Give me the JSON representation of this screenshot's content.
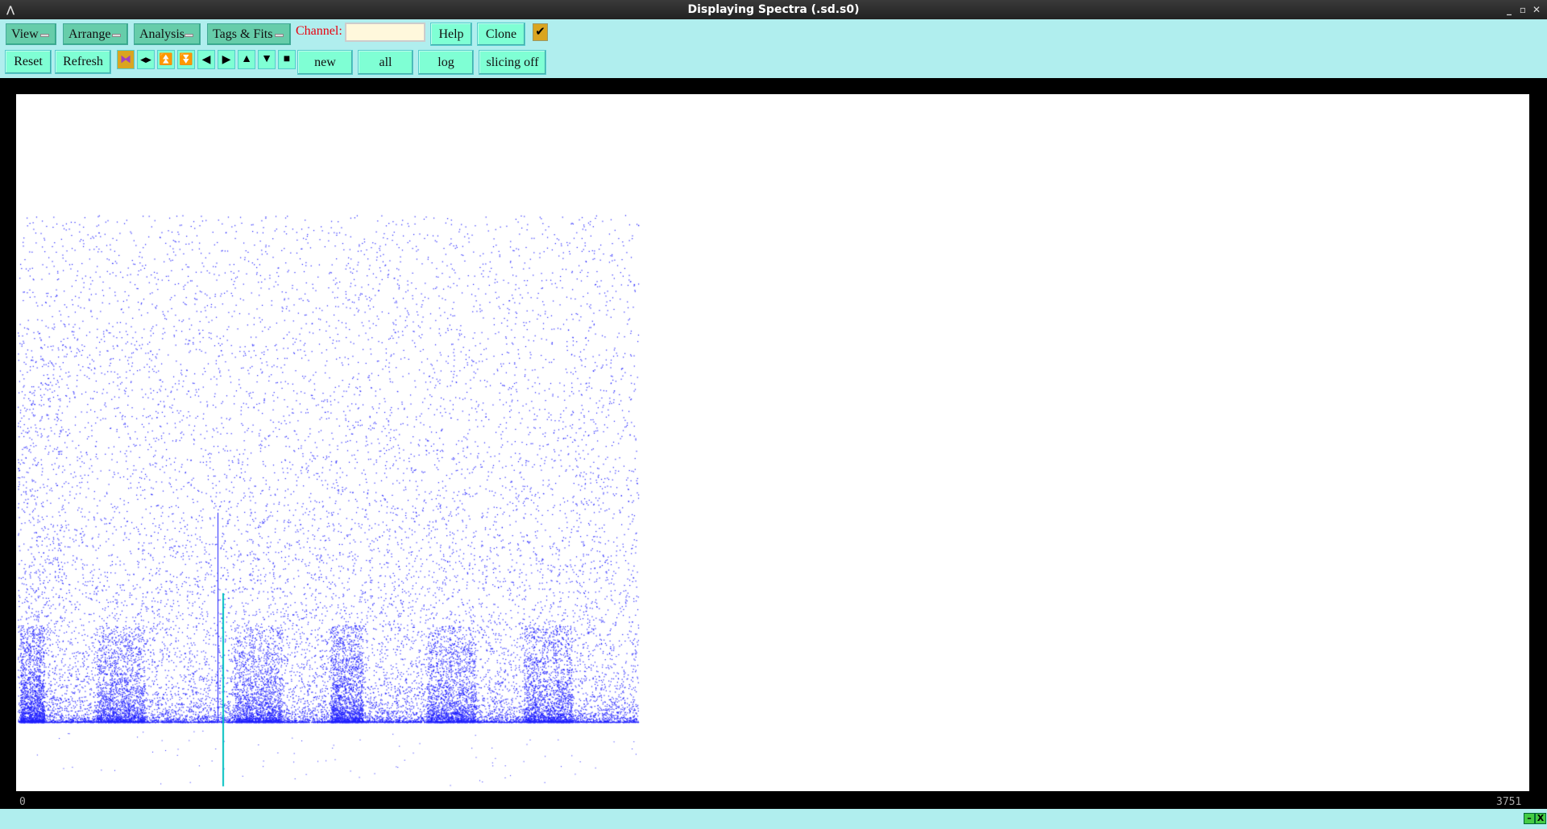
{
  "window": {
    "title": "Displaying Spectra (.sd.s0)"
  },
  "menus": [
    {
      "label": "View"
    },
    {
      "label": "Arrange"
    },
    {
      "label": "Analysis"
    },
    {
      "label": "Tags & Fits"
    }
  ],
  "channel": {
    "label": "Channel:",
    "value": ""
  },
  "buttons": {
    "help": "Help",
    "clone": "Clone",
    "reset": "Reset",
    "refresh": "Refresh",
    "new": "new",
    "all": "all",
    "log": "log",
    "slicing": "slicing off"
  },
  "checkbox": {
    "checked": true,
    "glyph": "✔"
  },
  "icon_buttons": [
    {
      "name": "expand-horizontal-icon",
      "glyph": "⧓"
    },
    {
      "name": "compress-horizontal-icon",
      "glyph": "◀▶"
    },
    {
      "name": "expand-vertical-icon",
      "glyph": "⏫"
    },
    {
      "name": "compress-vertical-icon",
      "glyph": "⏬"
    },
    {
      "name": "scroll-left-icon",
      "glyph": "◀"
    },
    {
      "name": "scroll-right-icon",
      "glyph": "▶"
    },
    {
      "name": "scroll-up-icon",
      "glyph": "▲"
    },
    {
      "name": "scroll-down-icon",
      "glyph": "▼"
    },
    {
      "name": "full-view-icon",
      "glyph": "■"
    }
  ],
  "axis": {
    "min_label": "0",
    "max_label": "3751"
  },
  "colors": {
    "points": "#2020ff",
    "marker": "#00c0c0"
  },
  "status": {
    "minimize": "–",
    "close": "X"
  }
}
